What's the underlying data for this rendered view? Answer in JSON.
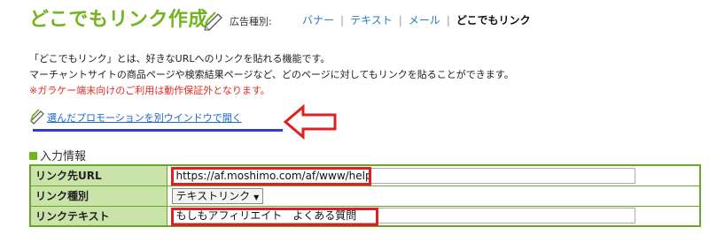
{
  "header": {
    "title": "どこでもリンク作成",
    "ad_type_label": "広告種別:",
    "ad_types": [
      {
        "label": "バナー",
        "current": false
      },
      {
        "label": "テキスト",
        "current": false
      },
      {
        "label": "メール",
        "current": false
      },
      {
        "label": "どこでもリンク",
        "current": true
      }
    ],
    "separator": "|"
  },
  "description": {
    "line1": "「どこでもリンク」とは、好きなURLへのリンクを貼れる機能です。",
    "line2": "マーチャントサイトの商品ページや検索結果ページなど、どのページに対してもリンクを貼ることができます。",
    "warning": "※ガラケー端末向けのご利用は動作保証外となります。"
  },
  "promo_link": "選んだプロモーションを別ウインドウで開く",
  "section": {
    "title": "入力情報"
  },
  "form": {
    "url_label": "リンク先URL",
    "url_value": "https://af.moshimo.com/af/www/help",
    "type_label": "リンク種別",
    "type_value": "テキストリンク",
    "text_label": "リンクテキスト",
    "text_value": "もしもアフィリエイト　よくある質問"
  },
  "icons": {
    "title_icon": "pencil-note-icon",
    "promo_icon": "pencil-note-icon",
    "annotation_arrow": "left-arrow-outline"
  },
  "colors": {
    "title_green": "#72b51e",
    "label_bg": "#c9e3a8",
    "table_border": "#6aa629",
    "link_blue": "#2a7ac8",
    "warning_red": "#e22a22",
    "highlight_red": "#e02020"
  }
}
